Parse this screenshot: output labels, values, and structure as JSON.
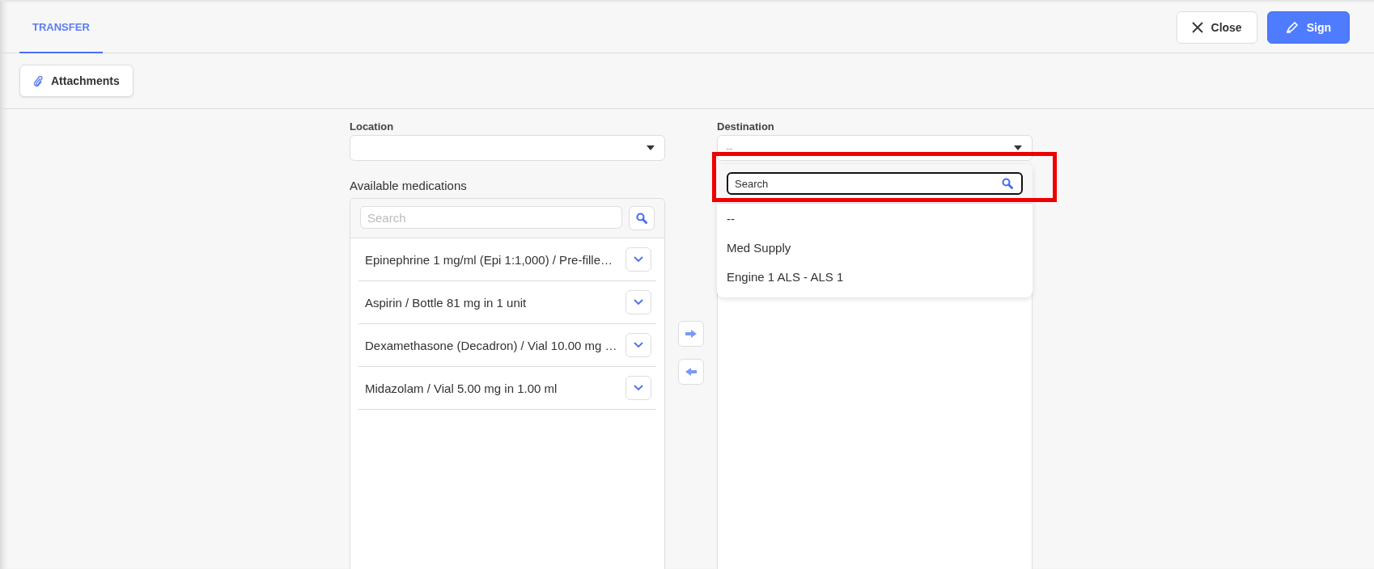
{
  "tabs": [
    {
      "label": "TRANSFER",
      "selected": true
    }
  ],
  "header_buttons": [
    {
      "kind": "close",
      "label": "Close"
    },
    {
      "kind": "sign",
      "label": "Sign"
    }
  ],
  "toolbar": {
    "attachments_button": "Attachments"
  },
  "location": {
    "label": "Location"
  },
  "destination": {
    "label": "Destination",
    "value": "--",
    "dropdown": {
      "expanded": true,
      "search": {
        "placeholder": "Search",
        "highlighted": true
      },
      "options": [
        {
          "label": "--"
        },
        {
          "label": "Med Supply"
        },
        {
          "label": "Engine 1 ALS - ALS 1"
        }
      ]
    }
  },
  "available_medications": {
    "title": "Available medications",
    "search": {
      "placeholder": "Search"
    },
    "items": [
      {
        "label": "Epinephrine 1 mg/ml (Epi 1:1,000) / Pre-fille…"
      },
      {
        "label": "Aspirin / Bottle 81 mg in 1 unit"
      },
      {
        "label": "Dexamethasone (Decadron) / Vial 10.00 mg …"
      },
      {
        "label": "Midazolam / Vial 5.00 mg in 1.00 ml"
      }
    ]
  }
}
